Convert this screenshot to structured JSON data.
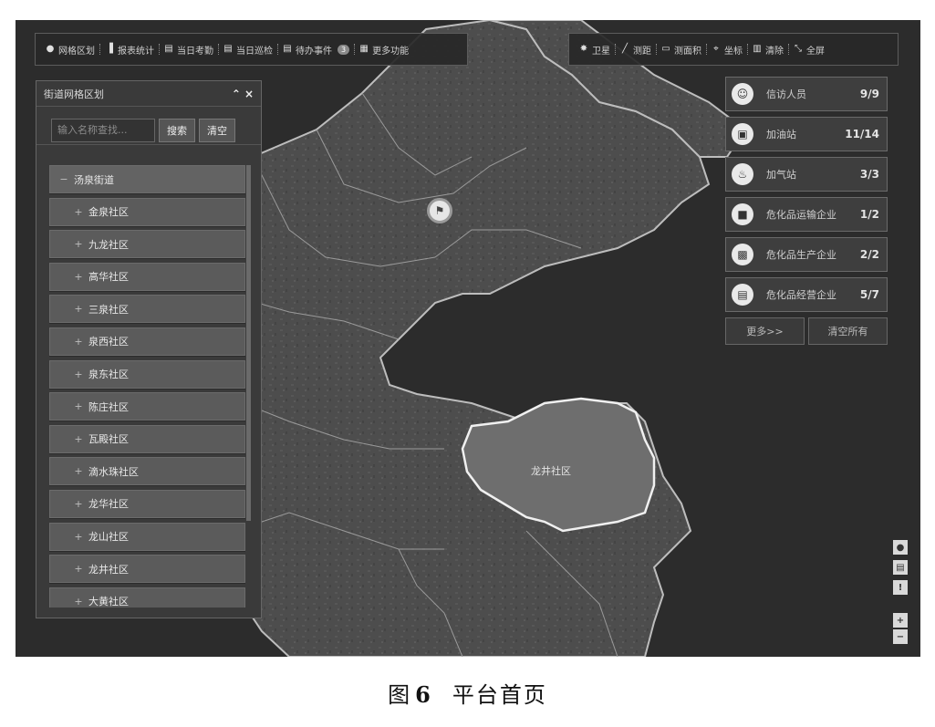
{
  "toolbar_left": [
    {
      "icon": "globe-icon",
      "label": "网格区划"
    },
    {
      "icon": "bar-chart-icon",
      "label": "报表统计"
    },
    {
      "icon": "calendar-icon",
      "label": "当日考勤"
    },
    {
      "icon": "calendar-icon",
      "label": "当日巡检"
    },
    {
      "icon": "calendar-icon",
      "label": "待办事件",
      "badge": "3"
    },
    {
      "icon": "grid-icon",
      "label": "更多功能"
    }
  ],
  "toolbar_right": [
    {
      "icon": "satellite-icon",
      "label": "卫星"
    },
    {
      "icon": "ruler-icon",
      "label": "测距"
    },
    {
      "icon": "area-icon",
      "label": "测面积"
    },
    {
      "icon": "coordinate-icon",
      "label": "坐标"
    },
    {
      "icon": "trash-icon",
      "label": "清除"
    },
    {
      "icon": "fullscreen-icon",
      "label": "全屏"
    }
  ],
  "grid_panel": {
    "title": "街道网格区划",
    "search_placeholder": "输入名称查找...",
    "search_button": "搜索",
    "clear_button": "清空",
    "root": "汤泉街道",
    "communities": [
      "金泉社区",
      "九龙社区",
      "高华社区",
      "三泉社区",
      "泉西社区",
      "泉东社区",
      "陈庄社区",
      "瓦殿社区",
      "滴水珠社区",
      "龙华社区",
      "龙山社区",
      "龙井社区",
      "大黄社区"
    ]
  },
  "stats": [
    {
      "icon": "person-icon",
      "label": "信访人员",
      "count": "9/9"
    },
    {
      "icon": "gas-pump-icon",
      "label": "加油站",
      "count": "11/14"
    },
    {
      "icon": "flame-icon",
      "label": "加气站",
      "count": "3/3"
    },
    {
      "icon": "truck-icon",
      "label": "危化品运输企业",
      "count": "1/2"
    },
    {
      "icon": "factory-icon",
      "label": "危化品生产企业",
      "count": "2/2"
    },
    {
      "icon": "store-icon",
      "label": "危化品经营企业",
      "count": "5/7"
    }
  ],
  "stats_more": "更多>>",
  "stats_clear": "清空所有",
  "highlight_region": "龙井社区",
  "map_tools": [
    "person-icon",
    "layers-icon",
    "warning-icon",
    "zoom-in-icon",
    "zoom-out-icon"
  ],
  "caption": {
    "prefix": "图",
    "number": "6",
    "text": "平台首页"
  }
}
